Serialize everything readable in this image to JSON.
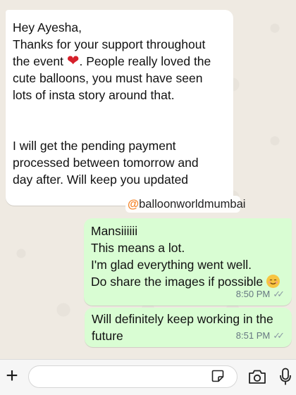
{
  "messages": {
    "incoming": {
      "line1": "Hey Ayesha,",
      "line2a": "Thanks for your support throughout",
      "line3a": "the event ",
      "line3b": ". People really loved the",
      "line4": "cute balloons, you must have seen",
      "line5": "lots of insta story around that.",
      "line6": "I will get the pending payment",
      "line7": "processed between tomorrow and",
      "line8": "day after. Will keep you updated"
    },
    "watermark": {
      "at": "@",
      "handle": "balloonworldmumbai"
    },
    "outgoing1": {
      "line1": "Mansiiiiii",
      "line2": "This means a lot.",
      "line3": "I'm glad everything went well.",
      "line4": "Do share the images if possible",
      "time": "8:50 PM"
    },
    "outgoing2": {
      "line1": "Will definitely keep working in the",
      "line2": "future",
      "time": "8:51 PM"
    }
  },
  "icons": {
    "heart": "red-heart-icon",
    "smile": "smiling-face-icon",
    "ticks": "double-check-icon"
  },
  "colors": {
    "outgoing_bubble": "#d9fdd3",
    "incoming_bubble": "#ffffff",
    "chat_background": "#efeae2"
  }
}
